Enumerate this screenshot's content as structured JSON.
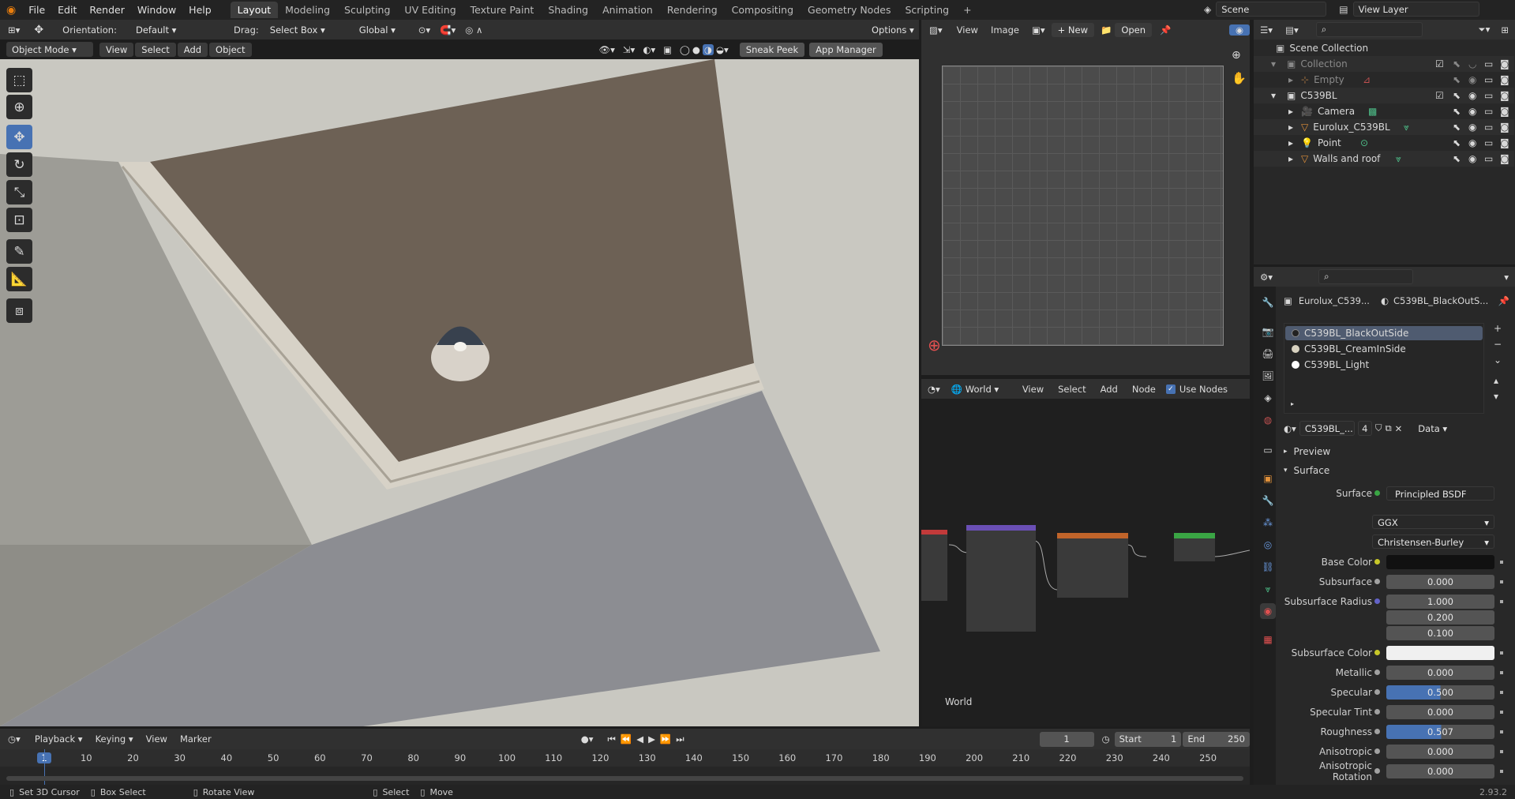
{
  "menu": [
    "File",
    "Edit",
    "Render",
    "Window",
    "Help"
  ],
  "workspaces": [
    "Layout",
    "Modeling",
    "Sculpting",
    "UV Editing",
    "Texture Paint",
    "Shading",
    "Animation",
    "Rendering",
    "Compositing",
    "Geometry Nodes",
    "Scripting"
  ],
  "active_workspace": "Layout",
  "add_tab": "+",
  "scene": {
    "name": "Scene",
    "view_layer": "View Layer"
  },
  "viewport": {
    "orientation_label": "Orientation:",
    "orientation": "Default",
    "drag_label": "Drag:",
    "drag": "Select Box",
    "transform": "Global",
    "options": "Options",
    "mode": "Object Mode",
    "menus": [
      "View",
      "Select",
      "Add",
      "Object"
    ],
    "sneak_peek": "Sneak Peek",
    "app_manager": "App Manager"
  },
  "image_editor": {
    "view": "View",
    "image": "Image",
    "new": "+ New",
    "open": "Open"
  },
  "node_editor": {
    "world": "World",
    "menus": [
      "View",
      "Select",
      "Add",
      "Node"
    ],
    "use_nodes": "Use Nodes",
    "label": "World"
  },
  "outliner": {
    "search_placeholder": "",
    "items": [
      {
        "name": "Scene Collection",
        "depth": 0
      },
      {
        "name": "Collection",
        "depth": 1,
        "dim": true
      },
      {
        "name": "Empty",
        "depth": 2,
        "dim": true
      },
      {
        "name": "C539BL",
        "depth": 1
      },
      {
        "name": "Camera",
        "depth": 2
      },
      {
        "name": "Eurolux_C539BL",
        "depth": 2
      },
      {
        "name": "Point",
        "depth": 2
      },
      {
        "name": "Walls and roof",
        "depth": 2
      }
    ]
  },
  "properties": {
    "object": "Eurolux_C539...",
    "material": "C539BL_BlackOutS...",
    "slots": [
      "C539BL_BlackOutSide",
      "C539BL_CreamInSide",
      "C539BL_Light"
    ],
    "mat_name": "C539BL_...",
    "users": "4",
    "data": "Data",
    "preview": "Preview",
    "surface_panel": "Surface",
    "surface_label": "Surface",
    "surface_shader": "Principled BSDF",
    "distribution": "GGX",
    "subsurface_method": "Christensen-Burley",
    "rows": [
      {
        "label": "Base Color",
        "value": "",
        "type": "color-black"
      },
      {
        "label": "Subsurface",
        "value": "0.000"
      },
      {
        "label": "Subsurface Radius",
        "value": "1.000"
      },
      {
        "label": "",
        "value": "0.200"
      },
      {
        "label": "",
        "value": "0.100"
      },
      {
        "label": "Subsurface Color",
        "value": "",
        "type": "color-white"
      },
      {
        "label": "Metallic",
        "value": "0.000"
      },
      {
        "label": "Specular",
        "value": "0.500",
        "fill": 0.5
      },
      {
        "label": "Specular Tint",
        "value": "0.000"
      },
      {
        "label": "Roughness",
        "value": "0.507",
        "fill": 0.507
      },
      {
        "label": "Anisotropic",
        "value": "0.000"
      },
      {
        "label": "Anisotropic Rotation",
        "value": "0.000"
      }
    ]
  },
  "timeline": {
    "menus": [
      "Playback",
      "Keying",
      "View",
      "Marker"
    ],
    "current_frame": "1",
    "start_label": "Start",
    "start": "1",
    "end_label": "End",
    "end": "250",
    "ticks": [
      "1",
      "10",
      "20",
      "30",
      "40",
      "50",
      "60",
      "70",
      "80",
      "90",
      "100",
      "110",
      "120",
      "130",
      "140",
      "150",
      "160",
      "170",
      "180",
      "190",
      "200",
      "210",
      "220",
      "230",
      "240",
      "250"
    ]
  },
  "status": {
    "items": [
      "Set 3D Cursor",
      "Box Select",
      "Rotate View",
      "Select",
      "Move"
    ],
    "version": "2.93.2"
  },
  "colors": {
    "accent": "#4772b3",
    "bg": "#1d1d1d",
    "panel": "#303030"
  }
}
